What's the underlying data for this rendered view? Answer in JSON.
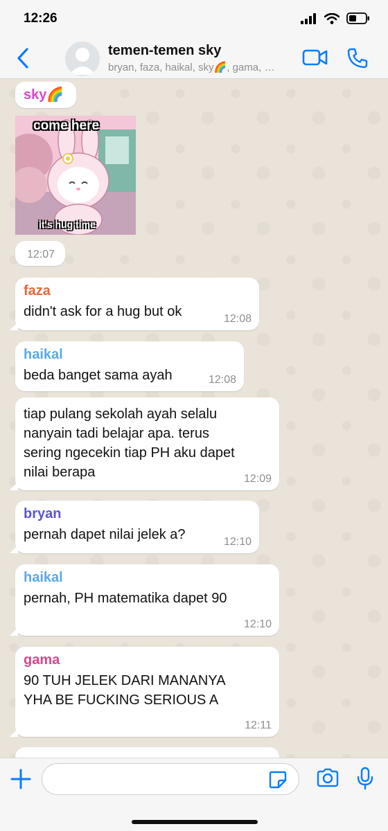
{
  "status": {
    "time": "12:26"
  },
  "header": {
    "title": "temen-temen sky",
    "members": "bryan, faza, haikal, sky🌈, gama, …"
  },
  "messages": [
    {
      "sender": "sky🌈",
      "sender_color": "#d946c8",
      "sticker_top": "come here",
      "sticker_bottom": "it's hug time",
      "time": "12:07"
    },
    {
      "sender": "faza",
      "sender_color": "#e8673c",
      "text": "didn't ask for a hug but ok",
      "time": "12:08"
    },
    {
      "sender": "haikal",
      "sender_color": "#5aa9e6",
      "text": "beda banget sama ayah",
      "time": "12:08"
    },
    {
      "lines": [
        "tiap pulang sekolah ayah selalu",
        "nanyain tadi belajar apa. terus",
        "sering ngecekin tiap PH aku dapet",
        "nilai berapa"
      ],
      "time": "12:09"
    },
    {
      "sender": "bryan",
      "sender_color": "#5b55d6",
      "text": "pernah dapet nilai jelek a?",
      "time": "12:10"
    },
    {
      "sender": "haikal",
      "sender_color": "#5aa9e6",
      "text": "pernah, PH matematika dapet 90",
      "time": "12:10"
    },
    {
      "sender": "gama",
      "sender_color": "#d9468c",
      "lines": [
        "90 TUH JELEK DARI MANANYA",
        "YHA BE FUCKING SERIOUS A"
      ],
      "time": "12:11"
    }
  ],
  "input": {
    "placeholder": ""
  },
  "icons": {
    "back": "chevron-left-icon",
    "video": "video-call-icon",
    "phone": "phone-icon",
    "plus": "plus-icon",
    "sticker": "sticker-icon",
    "camera": "camera-icon",
    "mic": "microphone-icon"
  },
  "colors": {
    "accent": "#0a7cff",
    "bubble": "#ffffff",
    "wallpaper": "#e9e3da"
  }
}
